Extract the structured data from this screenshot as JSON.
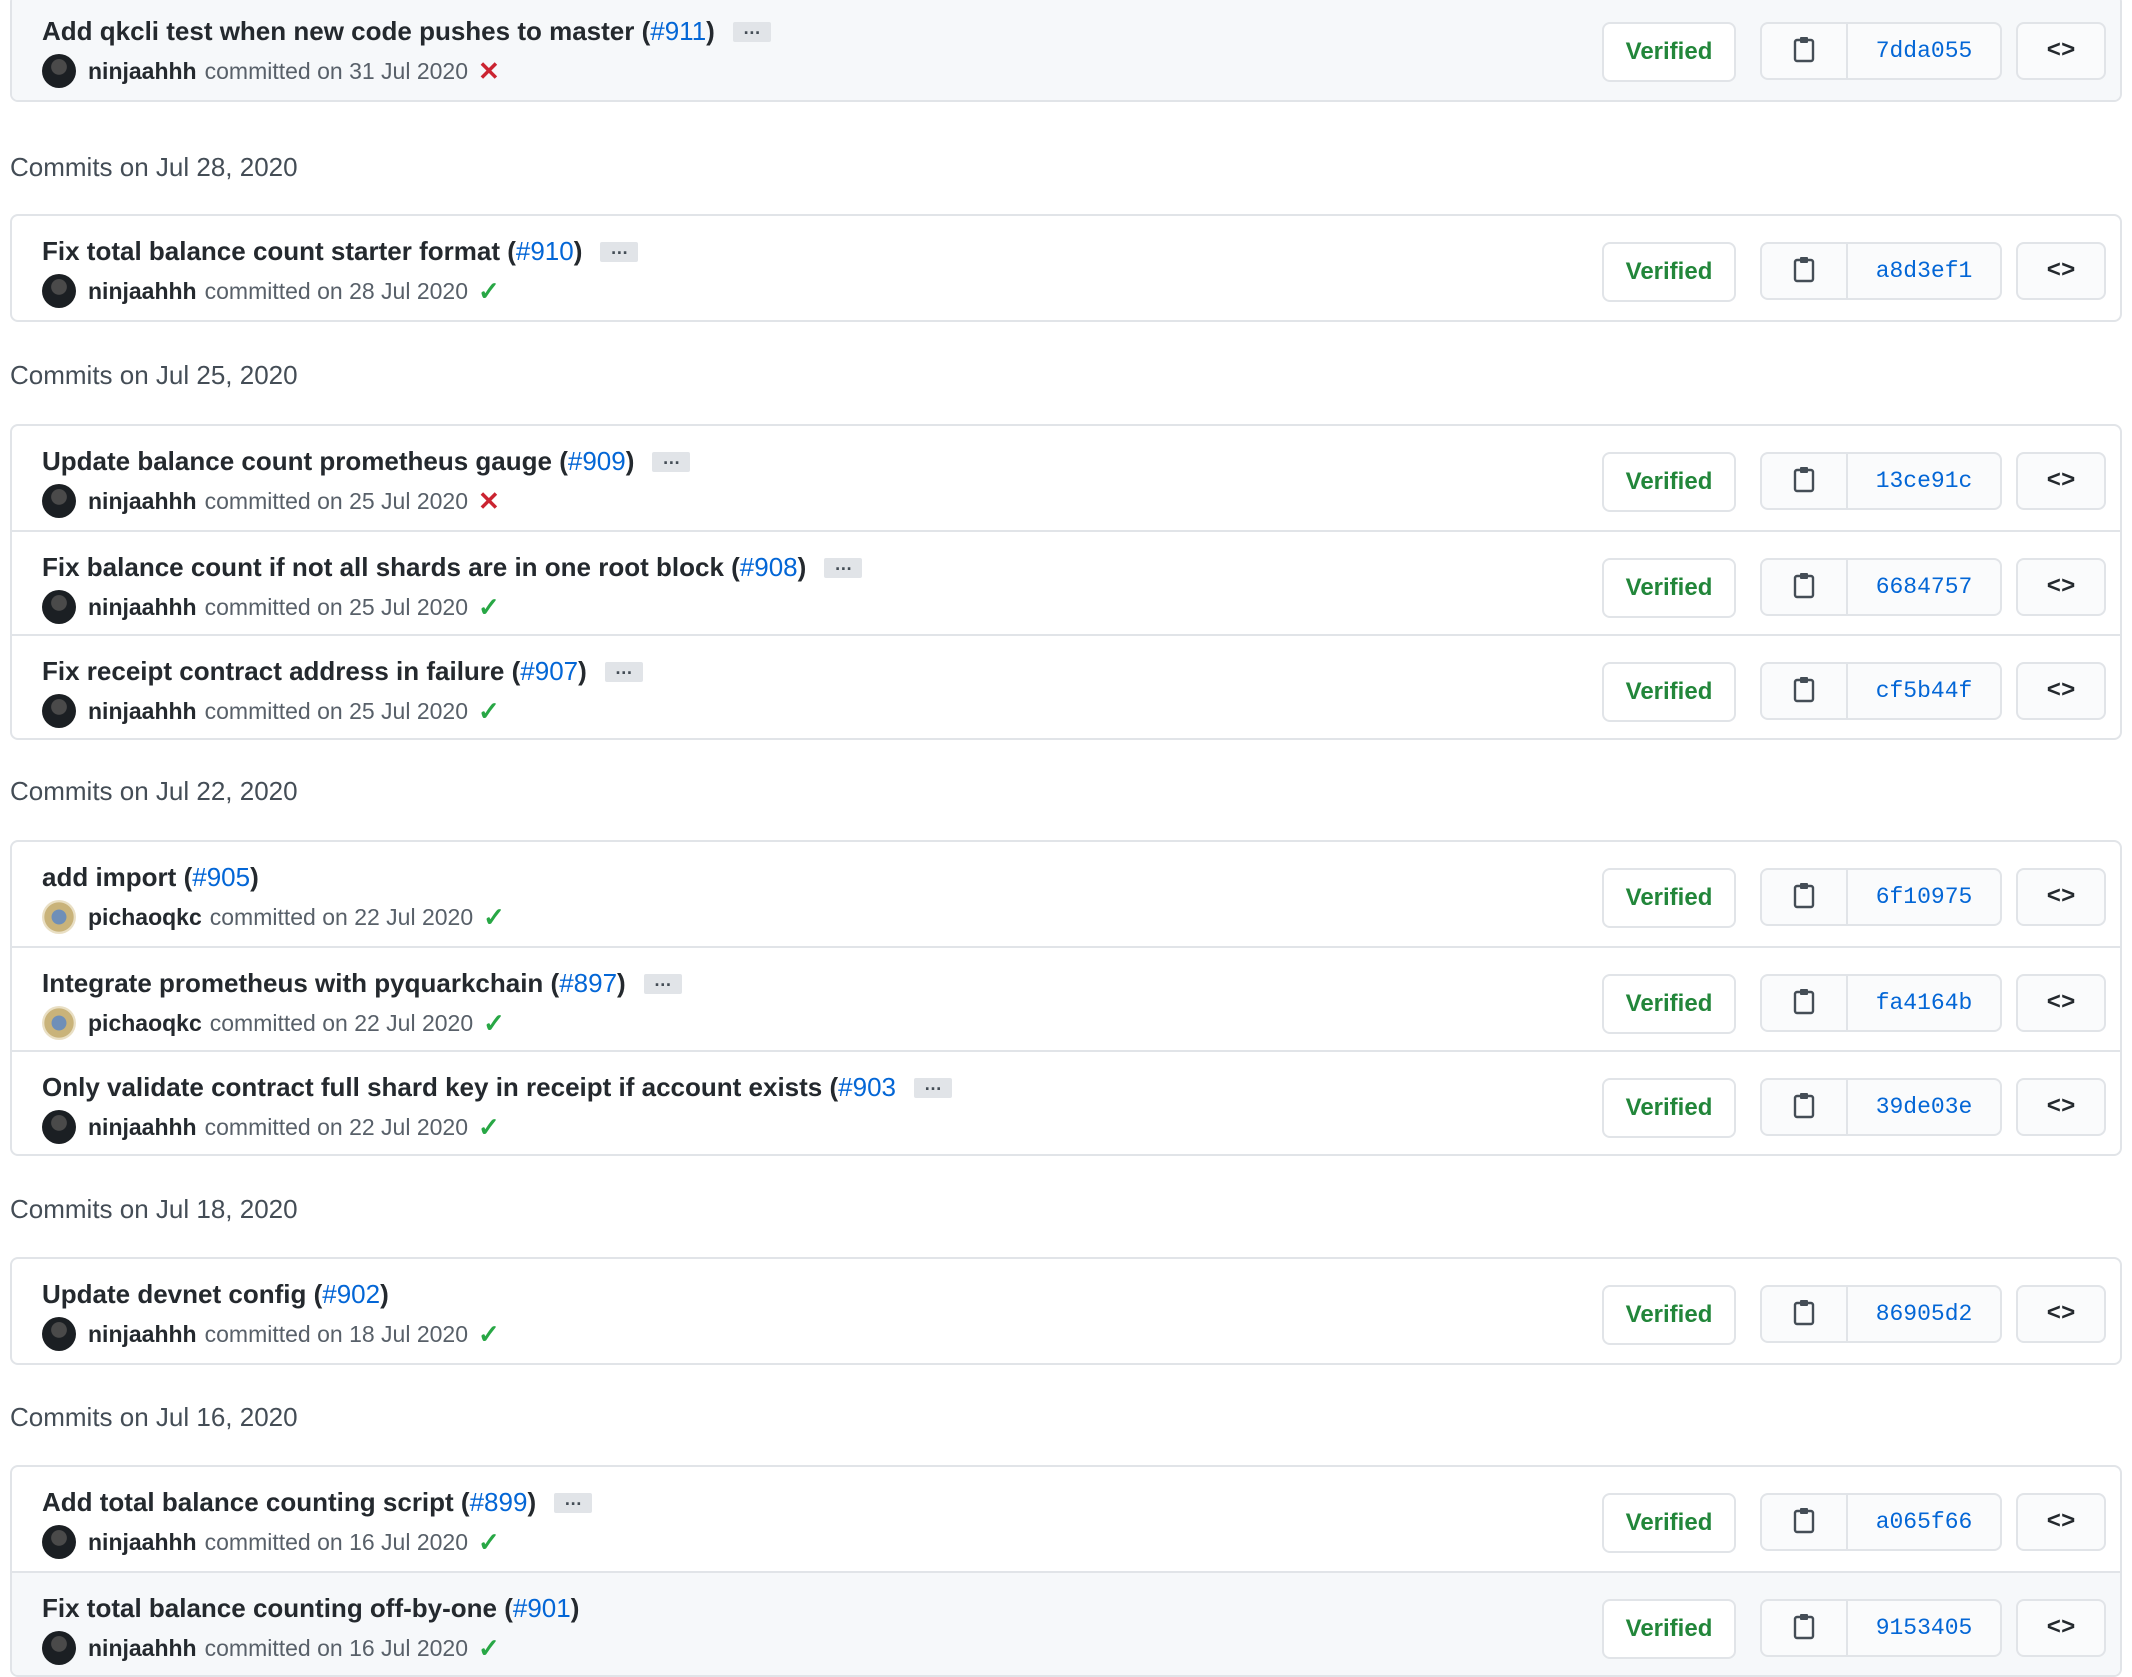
{
  "groups": [
    {
      "header": "",
      "commits": [
        {
          "title": "Add qkcli test when new code pushes to master",
          "pr": "#911",
          "ellipsis": true,
          "author": "ninjaahhh",
          "avatar": "ninja",
          "committed": "committed on 31 Jul 2020",
          "status": "fail",
          "verified": "Verified",
          "sha": "7dda055"
        }
      ]
    },
    {
      "header": "Commits on Jul 28, 2020",
      "commits": [
        {
          "title": "Fix total balance count starter format",
          "pr": "#910",
          "ellipsis": true,
          "author": "ninjaahhh",
          "avatar": "ninja",
          "committed": "committed on 28 Jul 2020",
          "status": "ok",
          "verified": "Verified",
          "sha": "a8d3ef1"
        }
      ]
    },
    {
      "header": "Commits on Jul 25, 2020",
      "commits": [
        {
          "title": "Update balance count prometheus gauge",
          "pr": "#909",
          "ellipsis": true,
          "author": "ninjaahhh",
          "avatar": "ninja",
          "committed": "committed on 25 Jul 2020",
          "status": "fail",
          "verified": "Verified",
          "sha": "13ce91c"
        },
        {
          "title": "Fix balance count if not all shards are in one root block",
          "pr": "#908",
          "ellipsis": true,
          "author": "ninjaahhh",
          "avatar": "ninja",
          "committed": "committed on 25 Jul 2020",
          "status": "ok",
          "verified": "Verified",
          "sha": "6684757"
        },
        {
          "title": "Fix receipt contract address in failure",
          "pr": "#907",
          "ellipsis": true,
          "author": "ninjaahhh",
          "avatar": "ninja",
          "committed": "committed on 25 Jul 2020",
          "status": "ok",
          "verified": "Verified",
          "sha": "cf5b44f"
        }
      ]
    },
    {
      "header": "Commits on Jul 22, 2020",
      "commits": [
        {
          "title": "add import",
          "pr": "#905",
          "ellipsis": false,
          "author": "pichaoqkc",
          "avatar": "pichao",
          "committed": "committed on 22 Jul 2020",
          "status": "ok",
          "verified": "Verified",
          "sha": "6f10975"
        },
        {
          "title": "Integrate prometheus with pyquarkchain",
          "pr": "#897",
          "ellipsis": true,
          "author": "pichaoqkc",
          "avatar": "pichao",
          "committed": "committed on 22 Jul 2020",
          "status": "ok",
          "verified": "Verified",
          "sha": "fa4164b"
        },
        {
          "title": "Only validate contract full shard key in receipt if account exists",
          "pr": "#903",
          "ellipsis": true,
          "no_close_paren": true,
          "author": "ninjaahhh",
          "avatar": "ninja",
          "committed": "committed on 22 Jul 2020",
          "status": "ok",
          "verified": "Verified",
          "sha": "39de03e"
        }
      ]
    },
    {
      "header": "Commits on Jul 18, 2020",
      "commits": [
        {
          "title": "Update devnet config",
          "pr": "#902",
          "ellipsis": false,
          "author": "ninjaahhh",
          "avatar": "ninja",
          "committed": "committed on 18 Jul 2020",
          "status": "ok",
          "verified": "Verified",
          "sha": "86905d2"
        }
      ]
    },
    {
      "header": "Commits on Jul 16, 2020",
      "commits": [
        {
          "title": "Add total balance counting script",
          "pr": "#899",
          "ellipsis": true,
          "author": "ninjaahhh",
          "avatar": "ninja",
          "committed": "committed on 16 Jul 2020",
          "status": "ok",
          "verified": "Verified",
          "sha": "a065f66"
        },
        {
          "title": "Fix total balance counting off-by-one",
          "pr": "#901",
          "ellipsis": false,
          "author": "ninjaahhh",
          "avatar": "ninja",
          "committed": "committed on 16 Jul 2020",
          "status": "ok",
          "verified": "Verified",
          "sha": "9153405"
        }
      ]
    }
  ],
  "icons": {
    "ok": "✓",
    "fail": "✕",
    "ellipsis": "…",
    "browse": "<>"
  },
  "colors": {
    "link": "#0366d6",
    "verified": "#22863a",
    "success": "#28a745",
    "failure": "#cb2431",
    "border": "#e1e4e8"
  }
}
